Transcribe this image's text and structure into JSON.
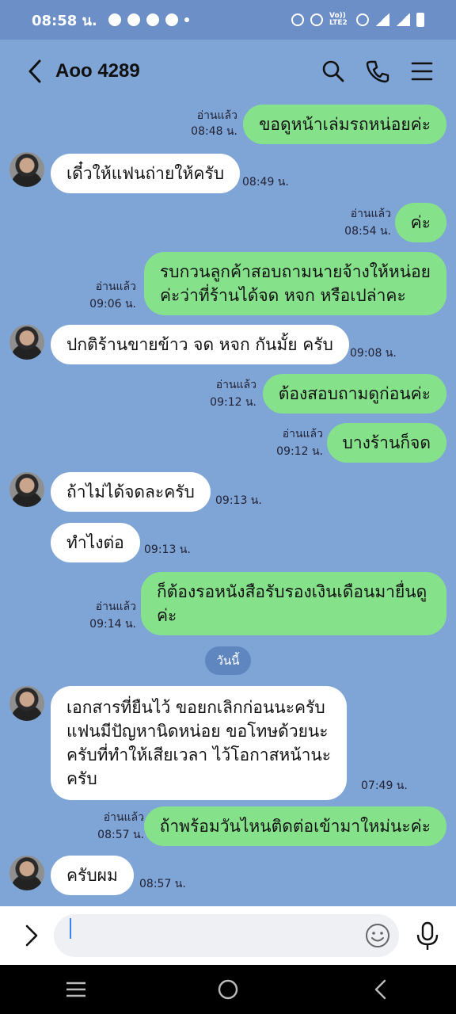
{
  "status_bar": {
    "time": "08:58 น.",
    "icons": [
      "app-icon",
      "facebook-icon",
      "messenger-icon",
      "app-icon",
      "dot-icon"
    ],
    "system_icons": [
      "alarm-icon",
      "mute-icon",
      "volte-icon",
      "wifi-icon",
      "signal-icon",
      "signal-icon",
      "battery-icon"
    ],
    "volte_label": "Vo)) LTE2"
  },
  "header": {
    "title": "Aoo 4289",
    "icons": [
      "search-icon",
      "phone-icon",
      "menu-icon"
    ]
  },
  "date_separator": "วันนี้",
  "messages": [
    {
      "side": "out",
      "text": "ขอดูหน้าเล่มรถหน่อยค่ะ",
      "read": "อ่านแล้ว",
      "time": "08:48 น."
    },
    {
      "side": "in",
      "text": "เดี๋วให้แฟนถ่ายให้ครับ",
      "time": "08:49 น."
    },
    {
      "side": "out",
      "text": "ค่ะ",
      "read": "อ่านแล้ว",
      "time": "08:54 น."
    },
    {
      "side": "out",
      "text_lines": [
        "รบกวนลูกค้าสอบถามนายจ้างให้หน่อย",
        "ค่ะว่าที่ร้านได้จด หจก หรือเปล่าคะ"
      ],
      "read": "อ่านแล้ว",
      "time": "09:06 น."
    },
    {
      "side": "in",
      "text": "ปกติร้านขายข้าว จด หจก กันมั้ย ครับ",
      "time": "09:08 น."
    },
    {
      "side": "out",
      "text": "ต้องสอบถามดูก่อนค่ะ",
      "read": "อ่านแล้ว",
      "time": "09:12 น."
    },
    {
      "side": "out",
      "text": "บางร้านก็จด",
      "read": "อ่านแล้ว",
      "time": "09:12 น."
    },
    {
      "side": "in",
      "text": "ถ้าไม่ได้จดละครับ",
      "time": "09:13 น."
    },
    {
      "side": "in",
      "text": "ทำไงต่อ",
      "time": "09:13 น."
    },
    {
      "side": "out",
      "text_lines": [
        "ก็ต้องรอหนังสือรับรองเงินเดือนมายื่นดู",
        "ค่ะ"
      ],
      "read": "อ่านแล้ว",
      "time": "09:14 น."
    },
    {
      "side": "in",
      "text_lines": [
        "เอกสารที่ยืนไว้ ขอยกเลิกก่อนนะครับ",
        "แฟนมีปัญหานิดหน่อย ขอโทษด้วยนะ",
        "ครับที่ทำให้เสียเวลา ไว้โอกาสหน้านะ",
        "ครับ"
      ],
      "time": "07:49 น."
    },
    {
      "side": "out",
      "text": "ถ้าพร้อมวันไหนติดต่อเข้ามาใหม่นะค่ะ",
      "read": "อ่านแล้ว",
      "time": "08:57 น."
    },
    {
      "side": "in",
      "text": "ครับผม",
      "time": "08:57 น."
    }
  ],
  "input": {
    "value": "",
    "placeholder": ""
  },
  "colors": {
    "chat_background": "#7fa4d6",
    "outgoing_bubble": "#86e28a",
    "incoming_bubble": "#ffffff",
    "date_pill": "#5f86bf"
  }
}
